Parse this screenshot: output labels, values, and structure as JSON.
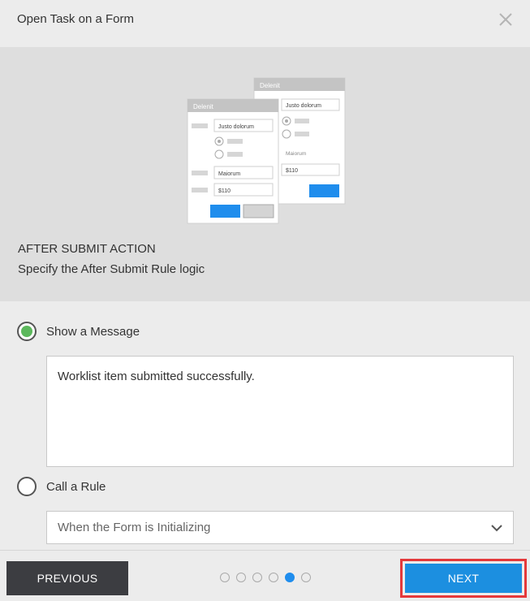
{
  "dialog": {
    "title": "Open Task on a Form",
    "close_icon": "close-icon"
  },
  "banner": {
    "heading": "AFTER SUBMIT ACTION",
    "subheading": "Specify the After Submit Rule logic",
    "illustration": {
      "back_form": {
        "title": "Delenit",
        "field_value": "Justo dolorum",
        "label": "Maiorum",
        "amount": "$110"
      },
      "front_form": {
        "title": "Delenit",
        "field_value": "Justo dolorum",
        "field2_value": "Maiorum",
        "amount": "$110"
      }
    }
  },
  "options": {
    "show_message": {
      "label": "Show a Message",
      "selected": true,
      "message_value": "Worklist item submitted successfully."
    },
    "call_rule": {
      "label": "Call a Rule",
      "selected": false,
      "select_value": "When the Form is Initializing"
    }
  },
  "footer": {
    "previous_label": "PREVIOUS",
    "next_label": "NEXT",
    "steps_total": 6,
    "current_step": 5
  },
  "colors": {
    "accent_blue": "#1c8fe0",
    "radio_selected": "#5cb85c",
    "highlight_red": "#e4393b",
    "prev_button": "#3c3d41"
  }
}
